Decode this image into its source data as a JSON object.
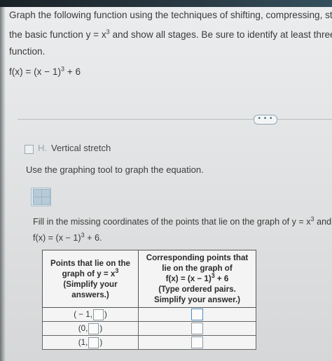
{
  "question": {
    "line1": "Graph the following function using the techniques of shifting, compressing, stret",
    "line2_prefix": "the basic function y = x",
    "line2_exp": "3",
    "line2_suffix": " and show all stages. Be sure to identify at least three k",
    "line3": "function.",
    "function_prefix": "f(x) = (x − 1)",
    "function_exp": "3",
    "function_suffix": " + 6"
  },
  "more_button": "• • •",
  "step": {
    "letter": "H.",
    "label": "Vertical stretch"
  },
  "instruction": "Use the graphing tool to graph the equation.",
  "fill": {
    "line1_prefix": "Fill in the missing coordinates of the points that lie on the graph of y = x",
    "line1_exp": "3",
    "line1_suffix": " and",
    "line2_prefix": "f(x) = (x − 1)",
    "line2_exp": "3",
    "line2_suffix": " + 6."
  },
  "table": {
    "header1": {
      "line1": "Points that lie on the",
      "line2_prefix": "graph of y = x",
      "line2_exp": "3",
      "line3": "(Simplify your",
      "line4": "answers.)"
    },
    "header2": {
      "line1": "Corresponding points that",
      "line2": "lie on the graph of",
      "line3_prefix": "f(x) = (x − 1)",
      "line3_exp": "3",
      "line3_suffix": " + 6",
      "line4": "(Type ordered pairs.",
      "line5": "Simplify your answer.)"
    },
    "rows": [
      {
        "x": "( − 1,",
        "close": ")"
      },
      {
        "x": "(0,",
        "close": ")"
      },
      {
        "x": "(1,",
        "close": ")"
      }
    ]
  }
}
